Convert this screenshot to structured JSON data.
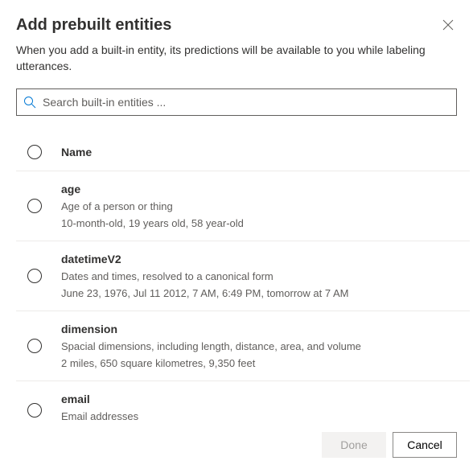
{
  "dialog": {
    "title": "Add prebuilt entities",
    "description": "When you add a built-in entity, its predictions will be available to you while labeling utterances."
  },
  "search": {
    "placeholder": "Search built-in entities ..."
  },
  "list": {
    "header": "Name",
    "items": [
      {
        "name": "age",
        "description": "Age of a person or thing",
        "examples": "10-month-old, 19 years old, 58 year-old"
      },
      {
        "name": "datetimeV2",
        "description": "Dates and times, resolved to a canonical form",
        "examples": "June 23, 1976, Jul 11 2012, 7 AM, 6:49 PM, tomorrow at 7 AM"
      },
      {
        "name": "dimension",
        "description": "Spacial dimensions, including length, distance, area, and volume",
        "examples": "2 miles, 650 square kilometres, 9,350 feet"
      },
      {
        "name": "email",
        "description": "Email addresses",
        "examples": ""
      }
    ]
  },
  "buttons": {
    "done": "Done",
    "cancel": "Cancel"
  }
}
